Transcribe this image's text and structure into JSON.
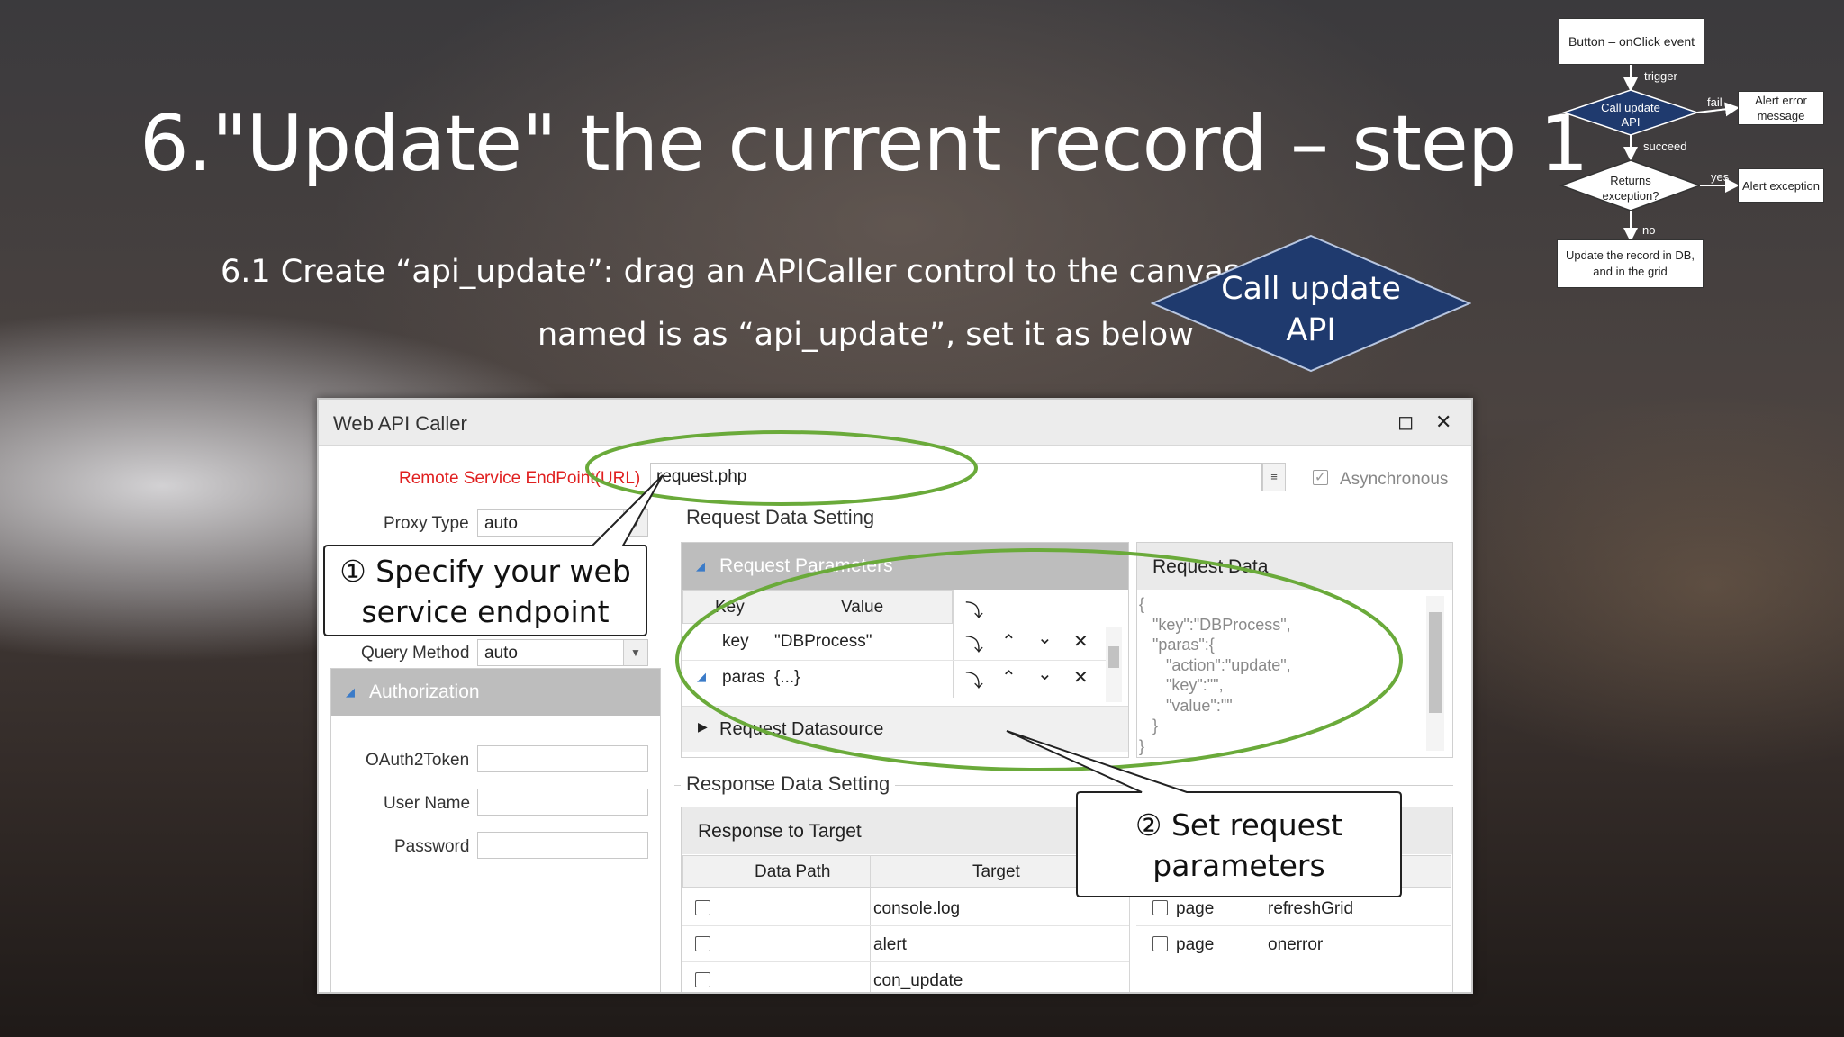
{
  "slide": {
    "title": "6.\"Update\" the current record – step 1",
    "subtitle_line1": "6.1 Create “api_update”: drag an APICaller  control to the canvas",
    "subtitle_line2": "named is as “api_update”, set it as below",
    "diamond_line1": "Call update",
    "diamond_line2": "API",
    "diamond_color": "#1f3a6e"
  },
  "flowchart": {
    "start": "Button – onClick event",
    "trigger": "trigger",
    "call_api": "Call  update API",
    "fail": "fail",
    "alert_error": "Alert error message",
    "succeed": "succeed",
    "returns_exception": "Returns exception?",
    "yes": "yes",
    "alert_exception": "Alert exception",
    "no": "no",
    "update_record": "Update the record in DB, and in the grid"
  },
  "dialog": {
    "title": "Web API Caller",
    "endpoint_label": "Remote Service EndPoint(URL)",
    "endpoint_value": "request.php",
    "async_label": "Asynchronous",
    "async_checked": true,
    "proxy_label": "Proxy Type",
    "proxy_value": "auto",
    "query_label": "Query Method",
    "query_value": "auto",
    "auth_header": "Authorization",
    "oauth_label": "OAuth2Token",
    "username_label": "User Name",
    "password_label": "Password",
    "request_group": "Request Data Setting",
    "request_params_header": "Request Parameters",
    "request_data_header": "Request Data",
    "params_cols": [
      "Key",
      "Value"
    ],
    "params_rows": [
      {
        "key": "key",
        "value": "\"DBProcess\""
      },
      {
        "key": "paras",
        "value": "{...}"
      }
    ],
    "request_datasource": "Request Datasource",
    "request_json": "{\n   \"key\":\"DBProcess\",\n   \"paras\":{\n      \"action\":\"update\",\n      \"key\":\"\",\n      \"value\":\"\"\n   }\n}",
    "response_group": "Response Data Setting",
    "response_target_header": "Response to Target",
    "resp_cols": [
      "Data Path",
      "Target"
    ],
    "resp_rows": [
      "console.log",
      "alert",
      "con_update"
    ],
    "right_rows": [
      {
        "type": "page",
        "target": "refreshGrid"
      },
      {
        "type": "page",
        "target": "onerror"
      }
    ]
  },
  "callouts": {
    "one": "① Specify your web service endpoint",
    "one_line1": "① Specify your web",
    "one_line2": "service endpoint",
    "two_line1": "② Set request",
    "two_line2": "parameters",
    "ellipse_color": "#6aaa3a"
  }
}
